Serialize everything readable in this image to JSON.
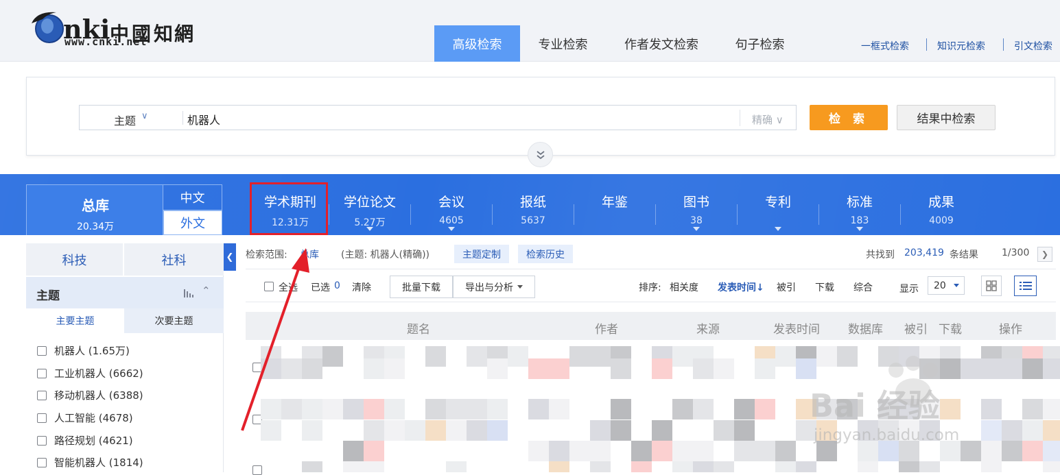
{
  "header": {
    "logo_text": "www.cnki.net",
    "logo_cn": [
      "中",
      "國",
      "知",
      "網"
    ],
    "tabs": [
      {
        "label": "高级检索",
        "active": true
      },
      {
        "label": "专业检索",
        "active": false
      },
      {
        "label": "作者发文检索",
        "active": false
      },
      {
        "label": "句子检索",
        "active": false
      }
    ],
    "links": [
      "一框式检索",
      "知识元检索",
      "引文检索"
    ]
  },
  "search": {
    "field_label": "主题",
    "query": "机器人",
    "match_mode": "精确",
    "search_button": "检 索",
    "within_button": "结果中检索"
  },
  "databases": {
    "total": {
      "label": "总库",
      "count": "20.34万"
    },
    "lang_zh": "中文",
    "lang_en": "外文",
    "items": [
      {
        "label": "学术期刊",
        "count": "12.31万",
        "dropdown": false
      },
      {
        "label": "学位论文",
        "count": "5.27万",
        "dropdown": true
      },
      {
        "label": "会议",
        "count": "4605",
        "dropdown": true
      },
      {
        "label": "报纸",
        "count": "5637",
        "dropdown": false
      },
      {
        "label": "年鉴",
        "count": "",
        "dropdown": false
      },
      {
        "label": "图书",
        "count": "38",
        "dropdown": true
      },
      {
        "label": "专利",
        "count": "",
        "dropdown": true
      },
      {
        "label": "标准",
        "count": "183",
        "dropdown": true
      },
      {
        "label": "成果",
        "count": "4009",
        "dropdown": false
      }
    ]
  },
  "sidebar": {
    "categories": [
      "科技",
      "社科"
    ],
    "facet_title": "主题",
    "subtabs": [
      "主要主题",
      "次要主题"
    ],
    "items": [
      {
        "label": "机器人 (1.65万)"
      },
      {
        "label": "工业机器人 (6662)"
      },
      {
        "label": "移动机器人 (6388)"
      },
      {
        "label": "人工智能 (4678)"
      },
      {
        "label": "路径规划 (4621)"
      },
      {
        "label": "智能机器人 (1814)"
      }
    ]
  },
  "results": {
    "scope_label": "检索范围:",
    "scope_value": "总库",
    "query_summary": "(主题: 机器人(精确))",
    "topic_custom": "主题定制",
    "history": "检索历史",
    "found_prefix": "共找到",
    "found_count": "203,419",
    "found_suffix": "条结果",
    "page": "1/300",
    "toolbar": {
      "select_all": "全选",
      "selected_label": "已选",
      "selected_count": "0",
      "clear": "清除",
      "batch_download": "批量下载",
      "export": "导出与分析",
      "sort_label": "排序:",
      "sort_options": [
        "相关度",
        "发表时间",
        "被引",
        "下载",
        "综合"
      ],
      "sort_active": "发表时间",
      "display_label": "显示",
      "page_size": "20"
    },
    "columns": [
      "题名",
      "作者",
      "来源",
      "发表时间",
      "数据库",
      "被引",
      "下载",
      "操作"
    ]
  },
  "watermark": {
    "brand": "Bai 经验",
    "url": "jingyan.baidu.com"
  },
  "colors": {
    "accent": "#2b6fe0",
    "search_button": "#f79a1f",
    "highlight_box": "#e3202a",
    "active_tab": "#5b9bf5"
  }
}
